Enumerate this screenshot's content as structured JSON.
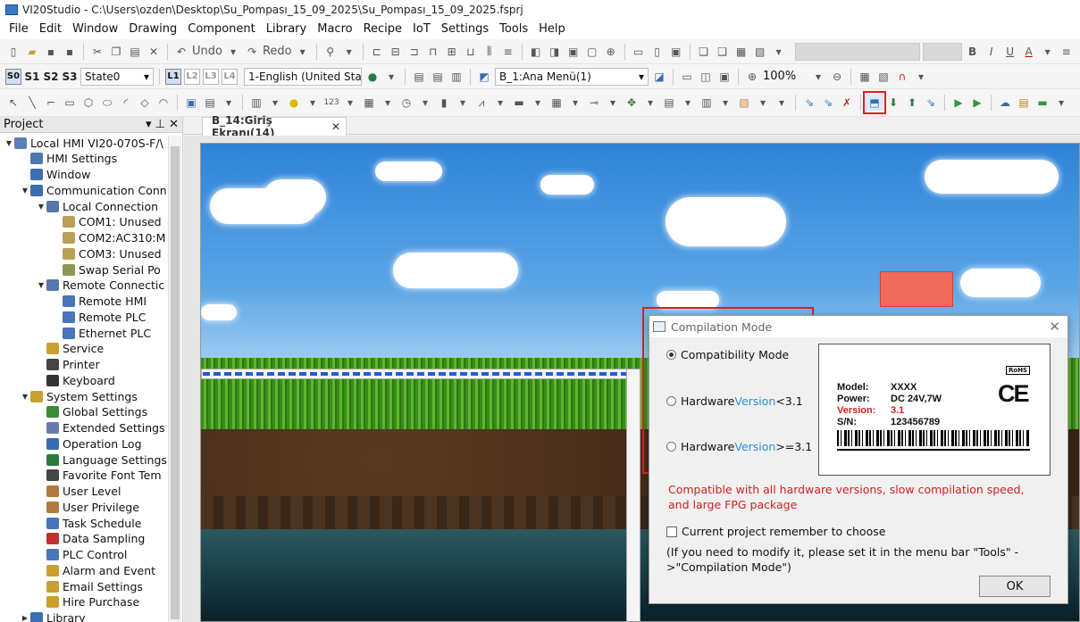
{
  "window": {
    "title": "VI20Studio - C:\\Users\\ozden\\Desktop\\Su_Pompası_15_09_2025\\Su_Pompası_15_09_2025.fsprj"
  },
  "menu": [
    "File",
    "Edit",
    "Window",
    "Drawing",
    "Component",
    "Library",
    "Macro",
    "Recipe",
    "IoT",
    "Settings",
    "Tools",
    "Help"
  ],
  "toolbar1": {
    "undo": "Undo",
    "redo": "Redo"
  },
  "toolbar2": {
    "state_buttons": [
      "S0",
      "S1",
      "S2",
      "S3"
    ],
    "state_select": "State0",
    "layer_buttons": [
      "L1",
      "L2",
      "L3",
      "L4"
    ],
    "language_select": "1-English (United Sta",
    "screen_select": "B_1:Ana Menü(1)",
    "zoom": "100%"
  },
  "project_panel": {
    "title": "Project",
    "tree": [
      {
        "label": "Local HMI  VI20-070S-F/\\",
        "level": 0,
        "toggle": "▼",
        "icon": "#5a7fb5"
      },
      {
        "label": "HMI Settings",
        "level": 1,
        "toggle": "",
        "icon": "#4f77b0"
      },
      {
        "label": "Window",
        "level": 1,
        "toggle": "",
        "icon": "#3d6fb0"
      },
      {
        "label": "Communication Conn",
        "level": 1,
        "toggle": "▼",
        "icon": "#3c6db0"
      },
      {
        "label": "Local Connection",
        "level": 2,
        "toggle": "▼",
        "icon": "#5577aa"
      },
      {
        "label": "COM1: Unused",
        "level": 3,
        "toggle": "",
        "icon": "#b8a055"
      },
      {
        "label": "COM2:AC310:M",
        "level": 3,
        "toggle": "",
        "icon": "#b8a055"
      },
      {
        "label": "COM3: Unused",
        "level": 3,
        "toggle": "",
        "icon": "#b8a055"
      },
      {
        "label": "Swap Serial Po",
        "level": 3,
        "toggle": "",
        "icon": "#8a9a55"
      },
      {
        "label": "Remote Connectic",
        "level": 2,
        "toggle": "▼",
        "icon": "#5577aa"
      },
      {
        "label": "Remote HMI",
        "level": 3,
        "toggle": "",
        "icon": "#4a74b8"
      },
      {
        "label": "Remote PLC",
        "level": 3,
        "toggle": "",
        "icon": "#4a74b8"
      },
      {
        "label": "Ethernet PLC",
        "level": 3,
        "toggle": "",
        "icon": "#4a74b8"
      },
      {
        "label": "Service",
        "level": 2,
        "toggle": "",
        "icon": "#c8a030"
      },
      {
        "label": "Printer",
        "level": 2,
        "toggle": "",
        "icon": "#444444"
      },
      {
        "label": "Keyboard",
        "level": 2,
        "toggle": "",
        "icon": "#333333"
      },
      {
        "label": "System Settings",
        "level": 1,
        "toggle": "▼",
        "icon": "#c8a030"
      },
      {
        "label": "Global Settings",
        "level": 2,
        "toggle": "",
        "icon": "#3a8a3a"
      },
      {
        "label": "Extended Settings",
        "level": 2,
        "toggle": "",
        "icon": "#6a7ab0"
      },
      {
        "label": "Operation Log",
        "level": 2,
        "toggle": "",
        "icon": "#3a6ab0"
      },
      {
        "label": "Language Settings",
        "level": 2,
        "toggle": "",
        "icon": "#2e7a3e"
      },
      {
        "label": "Favorite Font Tem",
        "level": 2,
        "toggle": "",
        "icon": "#444444"
      },
      {
        "label": "User Level",
        "level": 2,
        "toggle": "",
        "icon": "#b07a40"
      },
      {
        "label": "User Privilege",
        "level": 2,
        "toggle": "",
        "icon": "#b07a40"
      },
      {
        "label": "Task Schedule",
        "level": 2,
        "toggle": "",
        "icon": "#4a74b8"
      },
      {
        "label": "Data Sampling",
        "level": 2,
        "toggle": "",
        "icon": "#c03030"
      },
      {
        "label": "PLC Control",
        "level": 2,
        "toggle": "",
        "icon": "#4a74b8"
      },
      {
        "label": "Alarm and Event",
        "level": 2,
        "toggle": "",
        "icon": "#c8a030"
      },
      {
        "label": "Email Settings",
        "level": 2,
        "toggle": "",
        "icon": "#c8a030"
      },
      {
        "label": "Hire Purchase",
        "level": 2,
        "toggle": "",
        "icon": "#c8a030"
      },
      {
        "label": "Library",
        "level": 1,
        "toggle": "▶",
        "icon": "#3d6fb0"
      }
    ]
  },
  "editor_tab": {
    "label": "B_14:Giriş Ekranı(14)",
    "close": "✕"
  },
  "dialog": {
    "title": "Compilation Mode",
    "options": [
      {
        "pre": "Compatibility Mode",
        "blue": "",
        "post": "",
        "selected": true
      },
      {
        "pre": "Hardware",
        "blue": "Version",
        "post": " <3.1",
        "selected": false
      },
      {
        "pre": "Hardware",
        "blue": "Version",
        "post": " >=3.1",
        "selected": false
      }
    ],
    "label_card": {
      "rohs": "RoHS",
      "ce": "CE",
      "rows": [
        {
          "key": "Model:",
          "value": "XXXX",
          "red": false
        },
        {
          "key": "Power:",
          "value": "DC 24V,7W",
          "red": false
        },
        {
          "key": "Version:",
          "value": "3.1",
          "red": true
        },
        {
          "key": "S/N:",
          "value": "123456789",
          "red": false
        }
      ]
    },
    "warning": "Compatible with all hardware versions, slow compilation speed, and large FPG package",
    "remember": "Current project remember to choose",
    "note": "(If you need to modify it, please set it in the menu bar \"Tools\" ->\"Compilation Mode\")",
    "ok": "OK"
  }
}
